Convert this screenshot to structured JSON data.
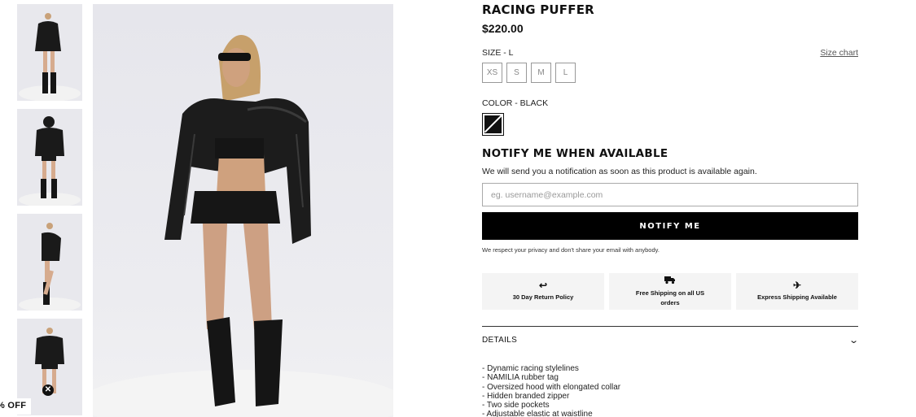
{
  "product": {
    "title": "RACING PUFFER",
    "price": "$220.00"
  },
  "size": {
    "label": "SIZE -  L",
    "chart_link": "Size chart",
    "options": [
      "XS",
      "S",
      "M",
      "L"
    ]
  },
  "color": {
    "label": "COLOR -  BLACK",
    "swatch": "#111111"
  },
  "notify": {
    "title": "NOTIFY ME WHEN AVAILABLE",
    "description": "We will send you a notification as soon as this product is available again.",
    "email_placeholder": "eg. username@example.com",
    "button_label": "NOTIFY ME",
    "privacy": "We respect your privacy and don't share your email with anybody."
  },
  "features": [
    {
      "icon": "return-arrow-icon",
      "label": "30 Day Return Policy"
    },
    {
      "icon": "truck-icon",
      "label": "Free Shipping on all US orders"
    },
    {
      "icon": "airplane-icon",
      "label": "Express Shipping Available"
    }
  ],
  "details": {
    "title": "DETAILS",
    "items": [
      "- Dynamic racing stylelines",
      "- NAMILIA rubber tag",
      "- Oversized hood with elongated collar",
      "- Hidden branded zipper",
      "- Two side pockets",
      "- Adjustable elastic at waistline"
    ]
  },
  "promo": {
    "label": "% OFF",
    "close_icon": "close-icon"
  },
  "colors": {
    "button": "#000000",
    "feature_bg": "#f4f4f4"
  }
}
